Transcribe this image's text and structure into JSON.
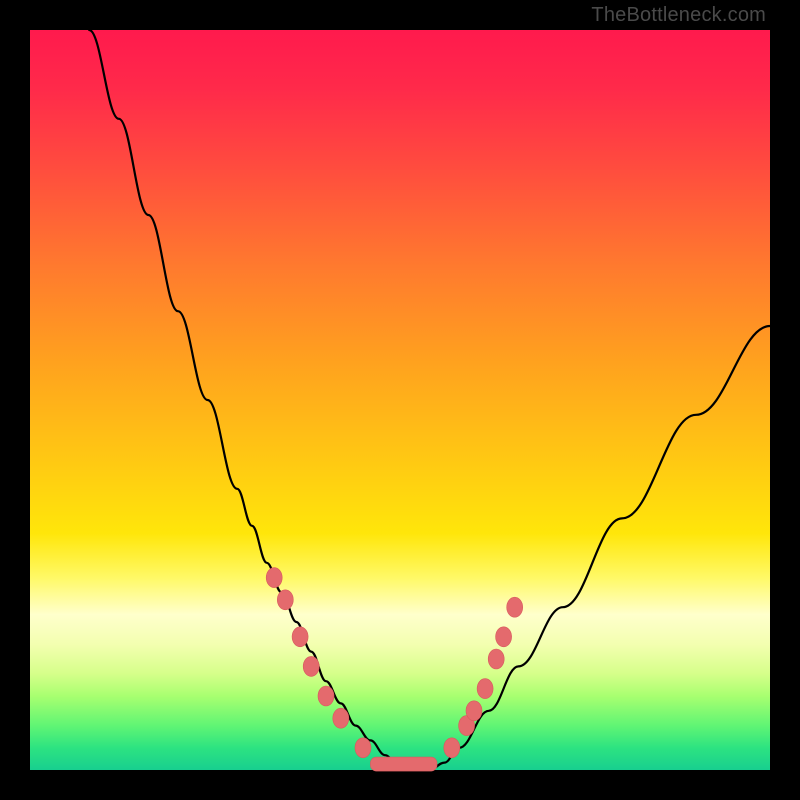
{
  "watermark": "TheBottleneck.com",
  "colors": {
    "bead": "#e46a6d",
    "curve": "#000000"
  },
  "chart_data": {
    "type": "line",
    "title": "",
    "xlabel": "",
    "ylabel": "",
    "xlim": [
      0,
      100
    ],
    "ylim": [
      0,
      100
    ],
    "grid": false,
    "legend": false,
    "annotations": [
      "TheBottleneck.com"
    ],
    "series": [
      {
        "name": "curve",
        "x": [
          8,
          12,
          16,
          20,
          24,
          28,
          30,
          32,
          34,
          36,
          38,
          40,
          42,
          44,
          46,
          48,
          50,
          52,
          54,
          56,
          58,
          62,
          66,
          72,
          80,
          90,
          100
        ],
        "y": [
          100,
          88,
          75,
          62,
          50,
          38,
          33,
          28,
          24,
          20,
          16,
          12,
          9,
          6,
          4,
          2,
          0,
          0,
          0,
          1,
          3,
          8,
          14,
          22,
          34,
          48,
          60
        ]
      }
    ],
    "markers_left": [
      {
        "x": 33,
        "y": 26
      },
      {
        "x": 34.5,
        "y": 23
      },
      {
        "x": 36.5,
        "y": 18
      },
      {
        "x": 38,
        "y": 14
      },
      {
        "x": 40,
        "y": 10
      },
      {
        "x": 42,
        "y": 7
      },
      {
        "x": 45,
        "y": 3
      }
    ],
    "markers_right": [
      {
        "x": 57,
        "y": 3
      },
      {
        "x": 59,
        "y": 6
      },
      {
        "x": 60,
        "y": 8
      },
      {
        "x": 61.5,
        "y": 11
      },
      {
        "x": 63,
        "y": 15
      },
      {
        "x": 64,
        "y": 18
      },
      {
        "x": 65.5,
        "y": 22
      }
    ],
    "flat_bar": {
      "x0": 46,
      "x1": 55,
      "y": 0.8
    }
  }
}
